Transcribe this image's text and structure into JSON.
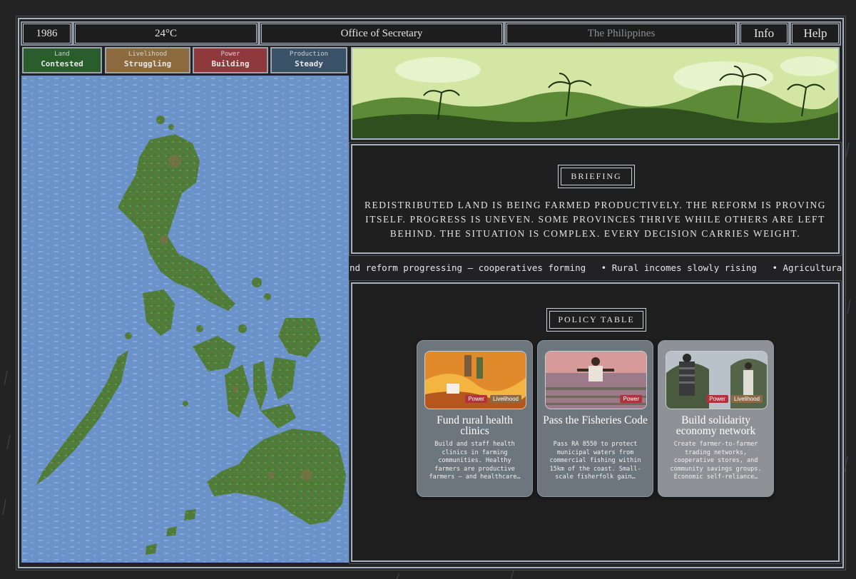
{
  "header": {
    "year": "1986",
    "temperature": "24°C",
    "office": "Office of Secretary",
    "country": "The Philippines",
    "info_label": "Info",
    "help_label": "Help"
  },
  "stats": [
    {
      "label": "Land",
      "value": "Contested",
      "color": "#2a5d2c"
    },
    {
      "label": "Livelihood",
      "value": "Struggling",
      "color": "#8c6a3e"
    },
    {
      "label": "Power",
      "value": "Building",
      "color": "#8e3a3c"
    },
    {
      "label": "Production",
      "value": "Steady",
      "color": "#3a5268"
    }
  ],
  "briefing": {
    "title": "BRIEFING",
    "text": "Redistributed land is being farmed productively. The reform is proving itself. Progress is uneven. Some provinces thrive while others are left behind. The situation is complex. Every decision carries weight."
  },
  "ticker": [
    "nd reform progressing — cooperatives forming",
    "• Rural incomes slowly rising",
    "• Agricultura"
  ],
  "policy": {
    "title": "POLICY TABLE",
    "cards": [
      {
        "title": "Fund rural health clinics",
        "desc": "Build and staff health clinics in farming communities. Healthy farmers are productive farmers — and healthcare…",
        "tags": [
          "Power",
          "Livelihood"
        ]
      },
      {
        "title": "Pass the Fisheries Code",
        "desc": "Pass RA 8550 to protect municipal waters from commercial fishing within 15km of the coast. Small-scale fisherfolk gain…",
        "tags": [
          "Power"
        ]
      },
      {
        "title": "Build solidarity economy network",
        "desc": "Create farmer-to-farmer trading networks, cooperative stores, and community savings groups. Economic self-reliance…",
        "tags": [
          "Power",
          "Livelihood"
        ]
      }
    ]
  },
  "colors": {
    "tag_power": "#b0323a",
    "tag_livelihood": "#8a6a44",
    "sea": "#6c93c9",
    "land": "#4e7d3a"
  }
}
